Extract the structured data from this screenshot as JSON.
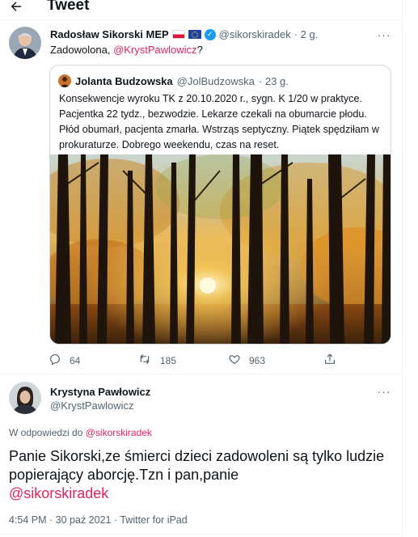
{
  "header": {
    "title": "Tweet"
  },
  "tweet1": {
    "author_name": "Radosław Sikorski MEP",
    "handle": "@sikorskiradek",
    "time": "· 2 g.",
    "text_prefix": "Zadowolona, ",
    "mention": "@KrystPawlowicz",
    "text_suffix": "?",
    "more_label": "···"
  },
  "quoted": {
    "author_name": "Jolanta Budzowska",
    "handle": "@JolBudzowska",
    "time": "· 23 g.",
    "text": "Konsekwencje wyroku TK z 20.10.2020 r., sygn. K 1/20 w praktyce. Pacjentka 22 tydz., bezwodzie. Lekarze czekali na obumarcie płodu. Płód obumarł, pacjenta zmarła. Wstrząs septyczny. Piątek spędziłam w prokuraturze. Dobrego weekendu, czas na reset."
  },
  "actions": {
    "replies": "64",
    "retweets": "185",
    "likes": "963"
  },
  "tweet2": {
    "author_name": "Krystyna Pawłowicz",
    "handle": "@KrystPawlowicz",
    "reply_prefix": "W odpowiedzi do ",
    "reply_to": "@sikorskiradek",
    "text": "Panie Sikorski,ze śmierci dzieci zadowoleni są tylko ludzie popierający aborcję.Tzn i pan,panie",
    "mention": "@sikorskiradek",
    "meta": "4:54 PM · 30 paź 2021 · Twitter for iPad"
  },
  "colors": {
    "accent": "#e0245e",
    "verified": "#1d9bf0",
    "muted": "#536471",
    "border": "#cfd9de"
  },
  "icons": [
    "back-arrow-icon",
    "verified-icon",
    "more-icon",
    "reply-icon",
    "retweet-icon",
    "like-icon",
    "share-icon"
  ]
}
